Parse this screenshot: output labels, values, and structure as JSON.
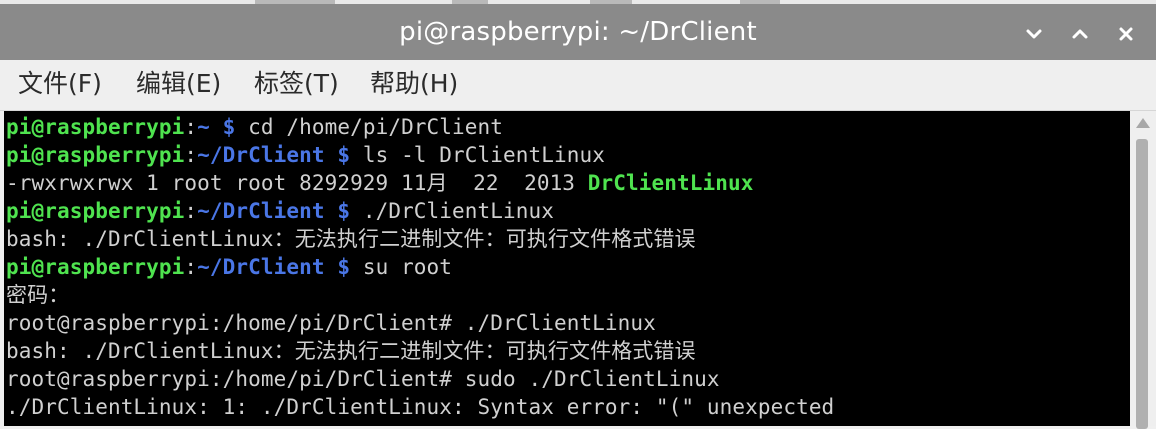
{
  "window": {
    "title": "pi@raspberrypi: ~/DrClient",
    "controls": [
      "chevron-down-icon",
      "chevron-up-icon",
      "close-icon"
    ]
  },
  "menu": [
    "文件(F)",
    "编辑(E)",
    "标签(T)",
    "帮助(H)"
  ],
  "colors": {
    "titlebar": "#8a8a8a",
    "prompt_user": "#4fe34f",
    "prompt_path": "#4a76e6",
    "terminal_text": "#d0d0d0",
    "terminal_bg": "#000000"
  },
  "terminal": {
    "lines": [
      {
        "user": "pi@raspberrypi",
        "sep": ":",
        "path": "~",
        "sym": " $",
        "cmd": " cd /home/pi/DrClient"
      },
      {
        "user": "pi@raspberrypi",
        "sep": ":",
        "path": "~/DrClient",
        "sym": " $",
        "cmd": " ls -l DrClientLinux"
      },
      {
        "text": "-rwxrwxrwx 1 root root 8292929 11月  22  2013 ",
        "highlight": "DrClientLinux"
      },
      {
        "user": "pi@raspberrypi",
        "sep": ":",
        "path": "~/DrClient",
        "sym": " $",
        "cmd": " ./DrClientLinux"
      },
      {
        "text": "bash: ./DrClientLinux：无法执行二进制文件：可执行文件格式错误"
      },
      {
        "user": "pi@raspberrypi",
        "sep": ":",
        "path": "~/DrClient",
        "sym": " $",
        "cmd": " su root"
      },
      {
        "text": "密码："
      },
      {
        "text": "root@raspberrypi:/home/pi/DrClient# ./DrClientLinux"
      },
      {
        "text": "bash: ./DrClientLinux：无法执行二进制文件：可执行文件格式错误"
      },
      {
        "text": "root@raspberrypi:/home/pi/DrClient# sudo ./DrClientLinux"
      },
      {
        "text": "./DrClientLinux: 1: ./DrClientLinux: Syntax error: \"(\" unexpected"
      }
    ]
  }
}
